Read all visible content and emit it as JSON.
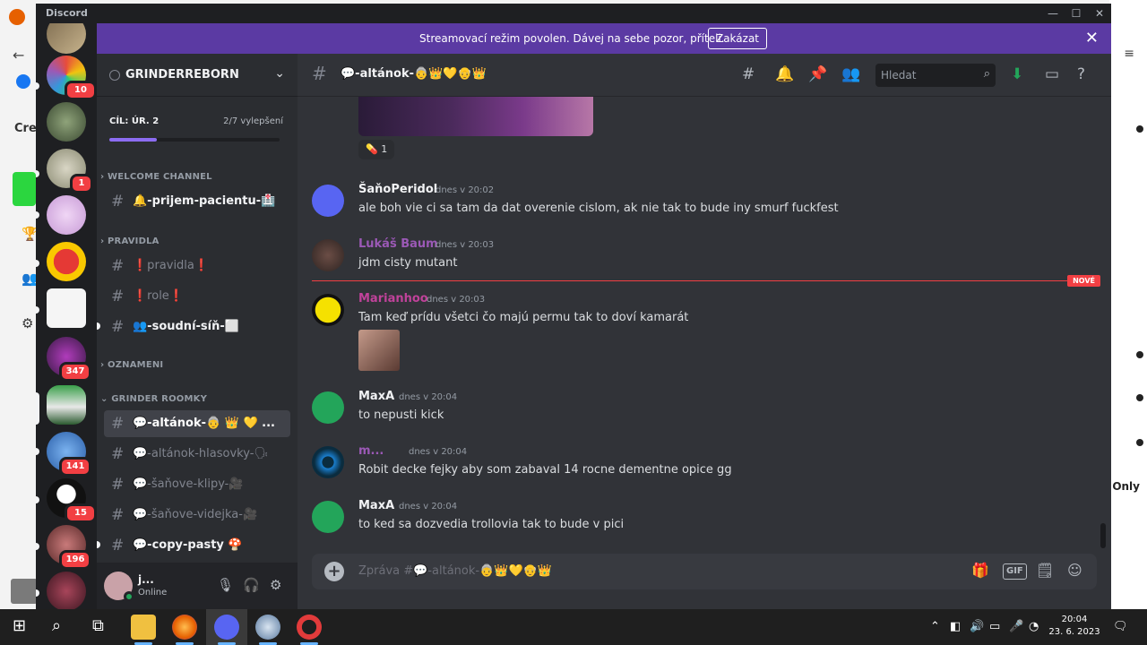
{
  "window": {
    "title": "Discord",
    "controls": [
      "—",
      "☐",
      "✕"
    ]
  },
  "banner": {
    "text": "Streamovací režim povolen. Dávej na sebe pozor, příteli.",
    "button": "Zakázat"
  },
  "background_app": {
    "partial_text_left": "Cre",
    "partial_text_right": "Only"
  },
  "servers": [
    {
      "badge": ""
    },
    {
      "badge": "10"
    },
    {
      "badge": ""
    },
    {
      "badge": "1"
    },
    {
      "badge": ""
    },
    {
      "badge": ""
    },
    {
      "badge": ""
    },
    {
      "badge": "347"
    },
    {
      "badge": ""
    },
    {
      "badge": "141"
    },
    {
      "badge": "15"
    },
    {
      "badge": "196"
    },
    {
      "badge": ""
    }
  ],
  "guild": {
    "name": "GRINDERREBORN",
    "goal_title": "CÍL: ÚR. 2",
    "goal_count": "2/7 vylepšení",
    "goal_progress": 0.28
  },
  "categories": {
    "welcome": "WELCOME CHANNEL",
    "pravidla": "PRAVIDLA",
    "oznameni": "OZNAMENI",
    "grinder": "GRINDER ROOMKY"
  },
  "channels": {
    "prijem": "🔔-prijem-pacientu-🏥",
    "pravidla": "❗pravidla❗",
    "role": "❗role❗",
    "soudni": "👥-soudní-síň-⬜",
    "altanok": "💬-altánok-👵 👑 💛 ...",
    "altanok_hlas": "💬-altánok-hlasovky-🗣",
    "klipy": "💬-šaňove-klipy-🎥",
    "videjka": "💬-šaňove-videjka-🎥",
    "copy": "💬-copy-pasty 🍄"
  },
  "user": {
    "name": "j...",
    "status": "Online"
  },
  "header": {
    "channel": "💬-altánok-👵👑💛👴👑",
    "search_placeholder": "Hledat"
  },
  "reaction": {
    "emoji": "💊",
    "count": "1"
  },
  "messages": [
    {
      "author": "ŠaňoPeridol",
      "time": "dnes v 20:02",
      "text": "ale boh vie ci sa tam da dat overenie cislom, ak nie tak to bude iny smurf fuckfest",
      "author_color": "#f2f3f5"
    },
    {
      "author": "Lukáš Baum",
      "time": "dnes v 20:03",
      "text": "jdm  cisty mutant",
      "author_color": "#9b59b6"
    },
    {
      "author": "Marianhoo",
      "time": "dnes v 20:03",
      "text": "Tam keď prídu všetci čo majú permu tak to doví kamarát",
      "author_color": "#c0429a"
    },
    {
      "author": "MaxA",
      "time": "dnes v 20:04",
      "text": "to nepusti kick",
      "author_color": "#f2f3f5"
    },
    {
      "author": "m...",
      "time": "dnes v 20:04",
      "text": "Robit decke fejky aby som zabaval 14 rocne dementne opice gg",
      "author_color": "#9b59b6"
    },
    {
      "author": "MaxA",
      "time": "dnes v 20:04",
      "text": "to ked sa dozvedia trollovia tak to bude v pici",
      "author_color": "#f2f3f5"
    }
  ],
  "new_label": "NOVÉ",
  "composer": {
    "placeholder": "Zpráva #💬-altánok-👵👑💛👴👑",
    "gif": "GIF"
  },
  "taskbar": {
    "time": "20:04",
    "date": "23. 6. 2023"
  },
  "colors": {
    "banner": "#5b3aa3",
    "accent": "#5865f2",
    "online": "#23a55a",
    "badge": "#f23f43"
  }
}
